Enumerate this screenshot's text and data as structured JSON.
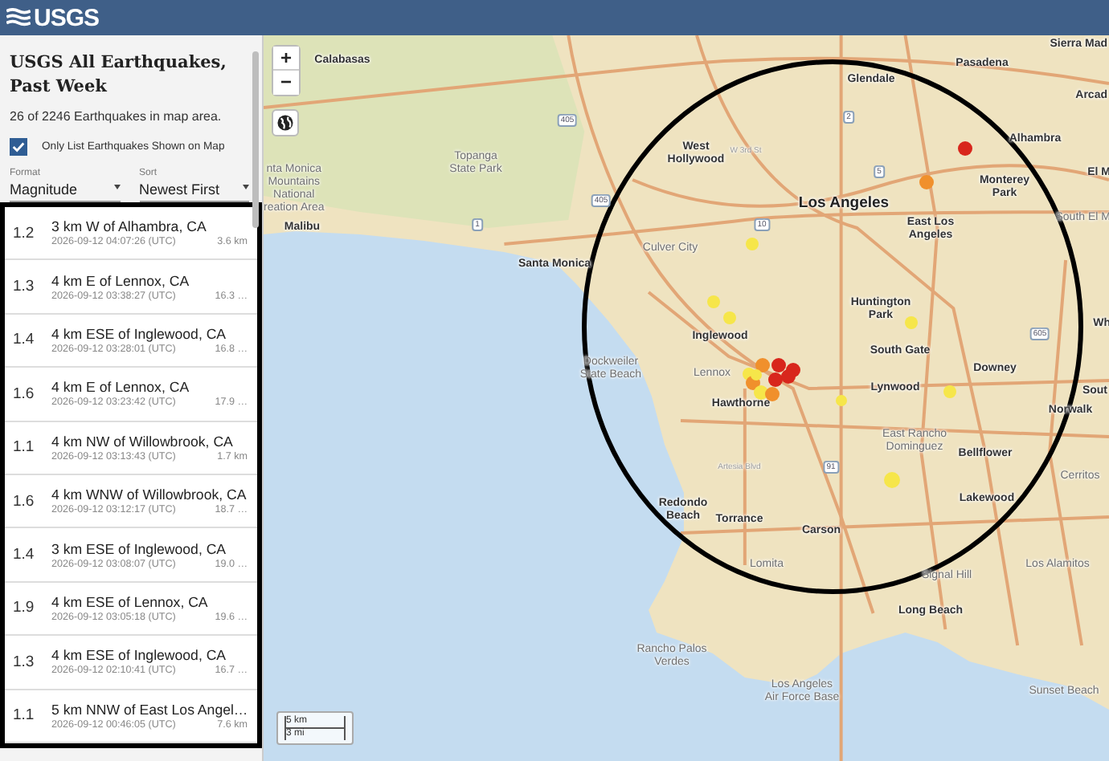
{
  "header": {
    "logo": "USGS"
  },
  "sidebar": {
    "title": "USGS All Earthquakes, Past Week",
    "summary": "26 of 2246 Earthquakes in map area.",
    "filter": {
      "label": "Only List Earthquakes Shown on Map",
      "checked": true
    },
    "format": {
      "label": "Format",
      "value": "Magnitude"
    },
    "sort": {
      "label": "Sort",
      "value": "Newest First"
    },
    "earthquakes": [
      {
        "magnitude": "1.2",
        "place": "3 km W of Alhambra, CA",
        "time": "2026-09-12 04:07:26 (UTC)",
        "depth": "3.6 km"
      },
      {
        "magnitude": "1.3",
        "place": "4 km E of Lennox, CA",
        "time": "2026-09-12 03:38:27 (UTC)",
        "depth": "16.3 …"
      },
      {
        "magnitude": "1.4",
        "place": "4 km ESE of Inglewood, CA",
        "time": "2026-09-12 03:28:01 (UTC)",
        "depth": "16.8 …"
      },
      {
        "magnitude": "1.6",
        "place": "4 km E of Lennox, CA",
        "time": "2026-09-12 03:23:42 (UTC)",
        "depth": "17.9 …"
      },
      {
        "magnitude": "1.1",
        "place": "4 km NW of Willowbrook, CA",
        "time": "2026-09-12 03:13:43 (UTC)",
        "depth": "1.7 km"
      },
      {
        "magnitude": "1.6",
        "place": "4 km WNW of Willowbrook, CA",
        "time": "2026-09-12 03:12:17 (UTC)",
        "depth": "18.7 …"
      },
      {
        "magnitude": "1.4",
        "place": "3 km ESE of Inglewood, CA",
        "time": "2026-09-12 03:08:07 (UTC)",
        "depth": "19.0 …"
      },
      {
        "magnitude": "1.9",
        "place": "4 km ESE of Lennox, CA",
        "time": "2026-09-12 03:05:18 (UTC)",
        "depth": "19.6 …"
      },
      {
        "magnitude": "1.3",
        "place": "4 km ESE of Inglewood, CA",
        "time": "2026-09-12 02:10:41 (UTC)",
        "depth": "16.7 …"
      },
      {
        "magnitude": "1.1",
        "place": "5 km NNW of East Los Angel…",
        "time": "2026-09-12 00:46:05 (UTC)",
        "depth": "7.6 km"
      }
    ]
  },
  "map": {
    "zoom_in": "+",
    "zoom_out": "−",
    "labels": [
      {
        "text": "Calabasas",
        "kind": "city"
      },
      {
        "text": "Glendale",
        "kind": "city"
      },
      {
        "text": "Pasadena",
        "kind": "city"
      },
      {
        "text": "Sierra Mad",
        "kind": "city"
      },
      {
        "text": "Arcad",
        "kind": "city"
      },
      {
        "text": "nta Monica\nMountains\nNational\nreation Area",
        "kind": "area"
      },
      {
        "text": "Topanga\nState Park",
        "kind": "area"
      },
      {
        "text": "W 3rd St",
        "kind": "street"
      },
      {
        "text": "West\nHollywood",
        "kind": "city"
      },
      {
        "text": "Alhambra",
        "kind": "city"
      },
      {
        "text": "Monterey\nPark",
        "kind": "city"
      },
      {
        "text": "Los Angeles",
        "kind": "major"
      },
      {
        "text": "El M",
        "kind": "city"
      },
      {
        "text": "Malibu",
        "kind": "city"
      },
      {
        "text": "East Los\nAngeles",
        "kind": "city"
      },
      {
        "text": "Santa Monica",
        "kind": "city"
      },
      {
        "text": "Culver City",
        "kind": "area"
      },
      {
        "text": "South El M",
        "kind": "area"
      },
      {
        "text": "Huntington\nPark",
        "kind": "city"
      },
      {
        "text": "Inglewood",
        "kind": "city"
      },
      {
        "text": "South Gate",
        "kind": "city"
      },
      {
        "text": "Wh",
        "kind": "city"
      },
      {
        "text": "Dockweiler\nState Beach",
        "kind": "area"
      },
      {
        "text": "Lennox",
        "kind": "area"
      },
      {
        "text": "Downey",
        "kind": "city"
      },
      {
        "text": "Sout",
        "kind": "city"
      },
      {
        "text": "Hawthorne",
        "kind": "city"
      },
      {
        "text": "Lynwood",
        "kind": "city"
      },
      {
        "text": "Norwalk",
        "kind": "city"
      },
      {
        "text": "East Rancho\nDominguez",
        "kind": "area"
      },
      {
        "text": "Bellflower",
        "kind": "city"
      },
      {
        "text": "Cerritos",
        "kind": "area"
      },
      {
        "text": "Artesia Blvd",
        "kind": "street"
      },
      {
        "text": "Redondo\nBeach",
        "kind": "city"
      },
      {
        "text": "Torrance",
        "kind": "city"
      },
      {
        "text": "Carson",
        "kind": "city"
      },
      {
        "text": "Lakewood",
        "kind": "city"
      },
      {
        "text": "Lomita",
        "kind": "area"
      },
      {
        "text": "Signal Hill",
        "kind": "area"
      },
      {
        "text": "Los Alamitos",
        "kind": "area"
      },
      {
        "text": "Long Beach",
        "kind": "city"
      },
      {
        "text": "Rancho Palos\nVerdes",
        "kind": "area"
      },
      {
        "text": "Los Angeles\nAir Force Base",
        "kind": "area"
      },
      {
        "text": "Sunset Beach",
        "kind": "area"
      },
      {
        "text": "405",
        "kind": "shield"
      },
      {
        "text": "405",
        "kind": "shield"
      },
      {
        "text": "10",
        "kind": "shield"
      },
      {
        "text": "2",
        "kind": "shield"
      },
      {
        "text": "5",
        "kind": "shield"
      },
      {
        "text": "1",
        "kind": "shield"
      },
      {
        "text": "91",
        "kind": "shield"
      },
      {
        "text": "605",
        "kind": "shield"
      }
    ],
    "markers": [
      {
        "color": "#d8261c"
      },
      {
        "color": "#f0902c"
      },
      {
        "color": "#f6e64a"
      },
      {
        "color": "#f6e64a"
      },
      {
        "color": "#f6e64a"
      },
      {
        "color": "#f6e64a"
      },
      {
        "color": "#f6e64a"
      },
      {
        "color": "#f0902c"
      },
      {
        "color": "#d8261c"
      },
      {
        "color": "#d8261c"
      },
      {
        "color": "#f0902c"
      },
      {
        "color": "#d8261c"
      },
      {
        "color": "#d8261c"
      },
      {
        "color": "#f6e64a"
      },
      {
        "color": "#f0902c"
      },
      {
        "color": "#f6e64a"
      },
      {
        "color": "#f6e64a"
      },
      {
        "color": "#f6e64a"
      },
      {
        "color": "#f6e64a"
      }
    ],
    "scale": {
      "metric": "5 km",
      "imperial": "3 mi"
    }
  }
}
